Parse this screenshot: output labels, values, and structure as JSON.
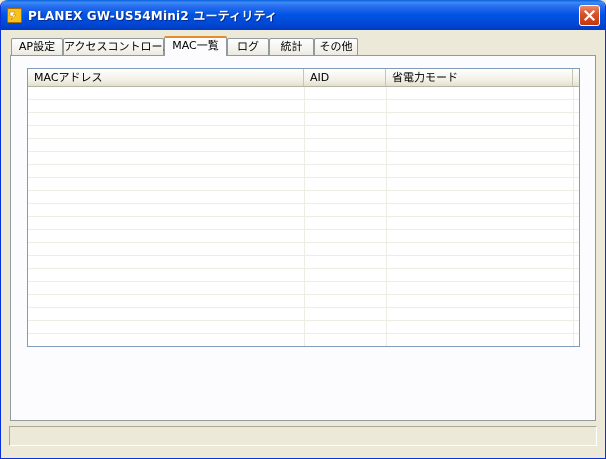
{
  "window": {
    "title": "PLANEX GW-US54Mini2 ユーティリティ",
    "accent_color": "#0054e3",
    "close_icon": "close-icon"
  },
  "tabs": [
    {
      "label": "AP設定",
      "active": false
    },
    {
      "label": "アクセスコントロール",
      "active": false
    },
    {
      "label": "MAC一覧",
      "active": true
    },
    {
      "label": "ログ",
      "active": false
    },
    {
      "label": "統計",
      "active": false
    },
    {
      "label": "その他",
      "active": false
    }
  ],
  "mac_list": {
    "columns": [
      "MACアドレス",
      "AID",
      "省電力モード"
    ],
    "rows": []
  }
}
